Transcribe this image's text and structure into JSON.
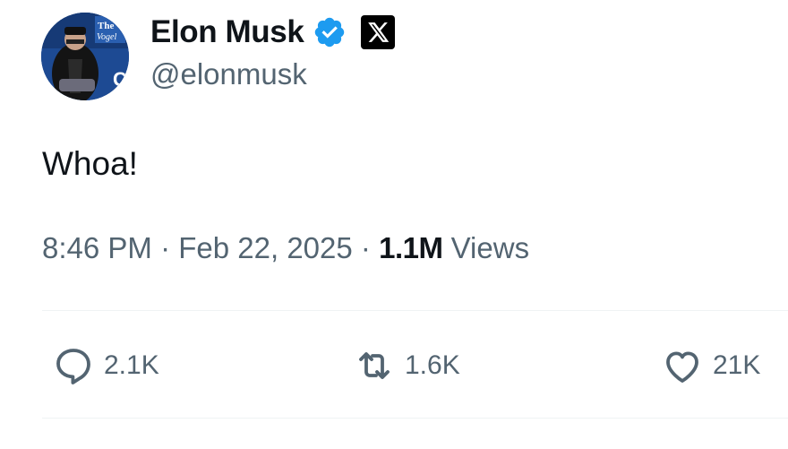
{
  "author": {
    "display_name": "Elon Musk",
    "handle": "@elonmusk",
    "verified_color": "#1d9bf0"
  },
  "tweet": {
    "text": "Whoa!",
    "time": "8:46 PM",
    "date": "Feb 22, 2025",
    "views_count": "1.1M",
    "views_label": "Views"
  },
  "actions": {
    "replies": "2.1K",
    "reposts": "1.6K",
    "likes": "21K"
  },
  "icons": {
    "verified": "verified-badge-icon",
    "platform": "x-logo-icon",
    "reply": "reply-bubble-icon",
    "repost": "repost-arrows-icon",
    "like": "heart-icon"
  }
}
